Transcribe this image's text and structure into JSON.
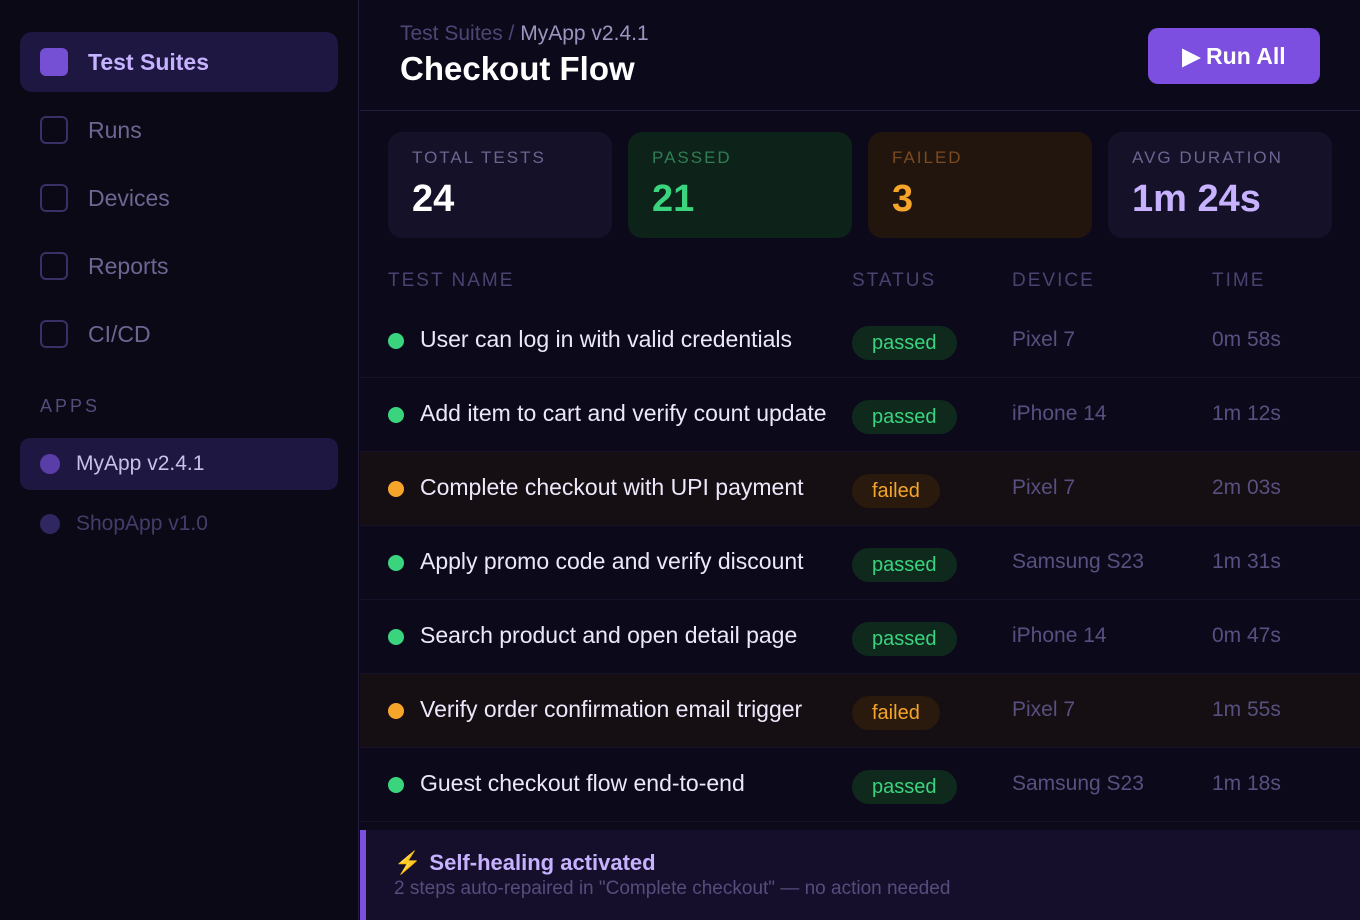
{
  "sidebar": {
    "nav": [
      {
        "label": "Test Suites",
        "icon": "test-suites-icon",
        "active": true
      },
      {
        "label": "Runs",
        "icon": "runs-icon",
        "active": false
      },
      {
        "label": "Devices",
        "icon": "devices-icon",
        "active": false
      },
      {
        "label": "Reports",
        "icon": "reports-icon",
        "active": false
      },
      {
        "label": "CI/CD",
        "icon": "cicd-icon",
        "active": false
      }
    ],
    "apps_heading": "APPS",
    "apps": [
      {
        "label": "MyApp v2.4.1",
        "active": true
      },
      {
        "label": "ShopApp v1.0",
        "active": false
      }
    ]
  },
  "header": {
    "breadcrumb_root": "Test Suites",
    "breadcrumb_sep": " / ",
    "breadcrumb_current": "MyApp v2.4.1",
    "title": "Checkout Flow",
    "run_all_icon": "▶",
    "run_all_label": "Run All"
  },
  "stats": {
    "total": {
      "label": "TOTAL TESTS",
      "value": "24"
    },
    "passed": {
      "label": "PASSED",
      "value": "21"
    },
    "failed": {
      "label": "FAILED",
      "value": "3"
    },
    "avg": {
      "label": "AVG DURATION",
      "value": "1m 24s"
    }
  },
  "table": {
    "columns": {
      "name": "TEST NAME",
      "status": "STATUS",
      "device": "DEVICE",
      "time": "TIME"
    },
    "rows": [
      {
        "name": "User can log in with valid credentials",
        "status": "passed",
        "device": "Pixel 7",
        "time": "0m 58s"
      },
      {
        "name": "Add item to cart and verify count update",
        "status": "passed",
        "device": "iPhone 14",
        "time": "1m 12s"
      },
      {
        "name": "Complete checkout with UPI payment",
        "status": "failed",
        "device": "Pixel 7",
        "time": "2m 03s"
      },
      {
        "name": "Apply promo code and verify discount",
        "status": "passed",
        "device": "Samsung S23",
        "time": "1m 31s"
      },
      {
        "name": "Search product and open detail page",
        "status": "passed",
        "device": "iPhone 14",
        "time": "0m 47s"
      },
      {
        "name": "Verify order confirmation email trigger",
        "status": "failed",
        "device": "Pixel 7",
        "time": "1m 55s"
      },
      {
        "name": "Guest checkout flow end-to-end",
        "status": "passed",
        "device": "Samsung S23",
        "time": "1m 18s"
      }
    ]
  },
  "banner": {
    "icon": "⚡",
    "title": "Self-healing activated",
    "subtitle": "2 steps auto-repaired in \"Complete checkout\" — no action needed"
  },
  "colors": {
    "accent": "#7c4fe0",
    "passed": "#3ad47f",
    "failed": "#f5a52a"
  }
}
